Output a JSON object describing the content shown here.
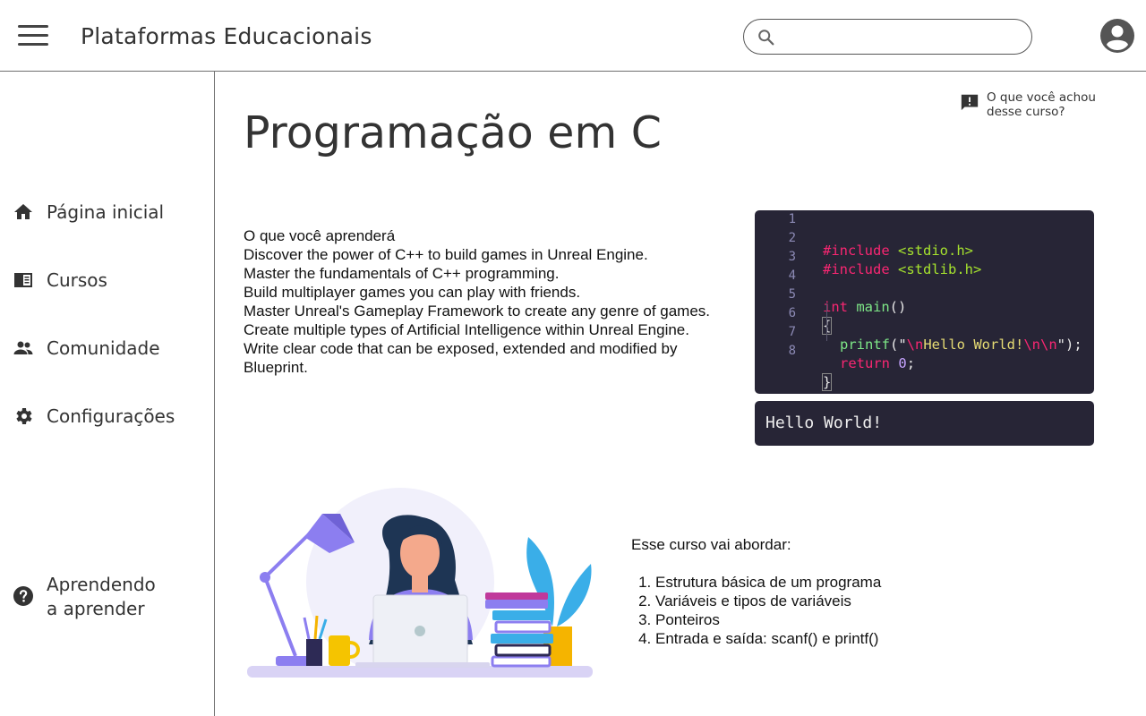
{
  "header": {
    "app_title": "Plataformas Educacionais",
    "search_placeholder": "",
    "search_value": ""
  },
  "sidebar": {
    "items": [
      {
        "label": "Página inicial",
        "icon": "home-icon"
      },
      {
        "label": "Cursos",
        "icon": "book-icon"
      },
      {
        "label": "Comunidade",
        "icon": "people-icon"
      },
      {
        "label": "Configurações",
        "icon": "gear-icon"
      },
      {
        "label": "Aprendendo\na aprender",
        "icon": "help-icon"
      }
    ]
  },
  "feedback": {
    "label": "O que você achou desse curso?",
    "icon": "feedback-icon"
  },
  "course": {
    "title": "Programação em C",
    "learn_heading": "O que você aprenderá",
    "learn_items": [
      "Discover the power of C++ to build games in Unreal Engine.",
      "Master the fundamentals of C++ programming.",
      "Build multiplayer games you can play with friends.",
      "Master Unreal's Gameplay Framework to create any genre of games.",
      "Create multiple types of Artificial Intelligence within Unreal Engine.",
      "Write clear code that can be exposed, extended and modified by Blueprint."
    ]
  },
  "code_editor": {
    "line_numbers": [
      "1",
      "2",
      "3",
      "4",
      "5",
      "6",
      "7",
      "8"
    ],
    "tokens": {
      "include": "#include",
      "stdio": "<stdio.h>",
      "stdlib": "<stdlib.h>",
      "int": "int",
      "main": "main",
      "parens": "()",
      "open_brace": "{",
      "printf": "printf",
      "lparen_quote": "(\"",
      "esc_n": "\\n",
      "hello": "Hello World!",
      "esc_nn": "\\n\\n",
      "close_quote_paren": "\");",
      "return": "return",
      "zero": "0",
      "semicolon": ";",
      "close_brace": "}"
    },
    "output": "Hello World!"
  },
  "topics": {
    "heading": "Esse curso vai abordar:",
    "items": [
      "Estrutura básica de um programa",
      "Variáveis e tipos de variáveis",
      "Ponteiros",
      "Entrada e saída: scanf() e printf()"
    ]
  },
  "colors": {
    "code_bg": "#272536",
    "accent_purple": "#8c7ef0",
    "plant_blue": "#3aaee8"
  }
}
